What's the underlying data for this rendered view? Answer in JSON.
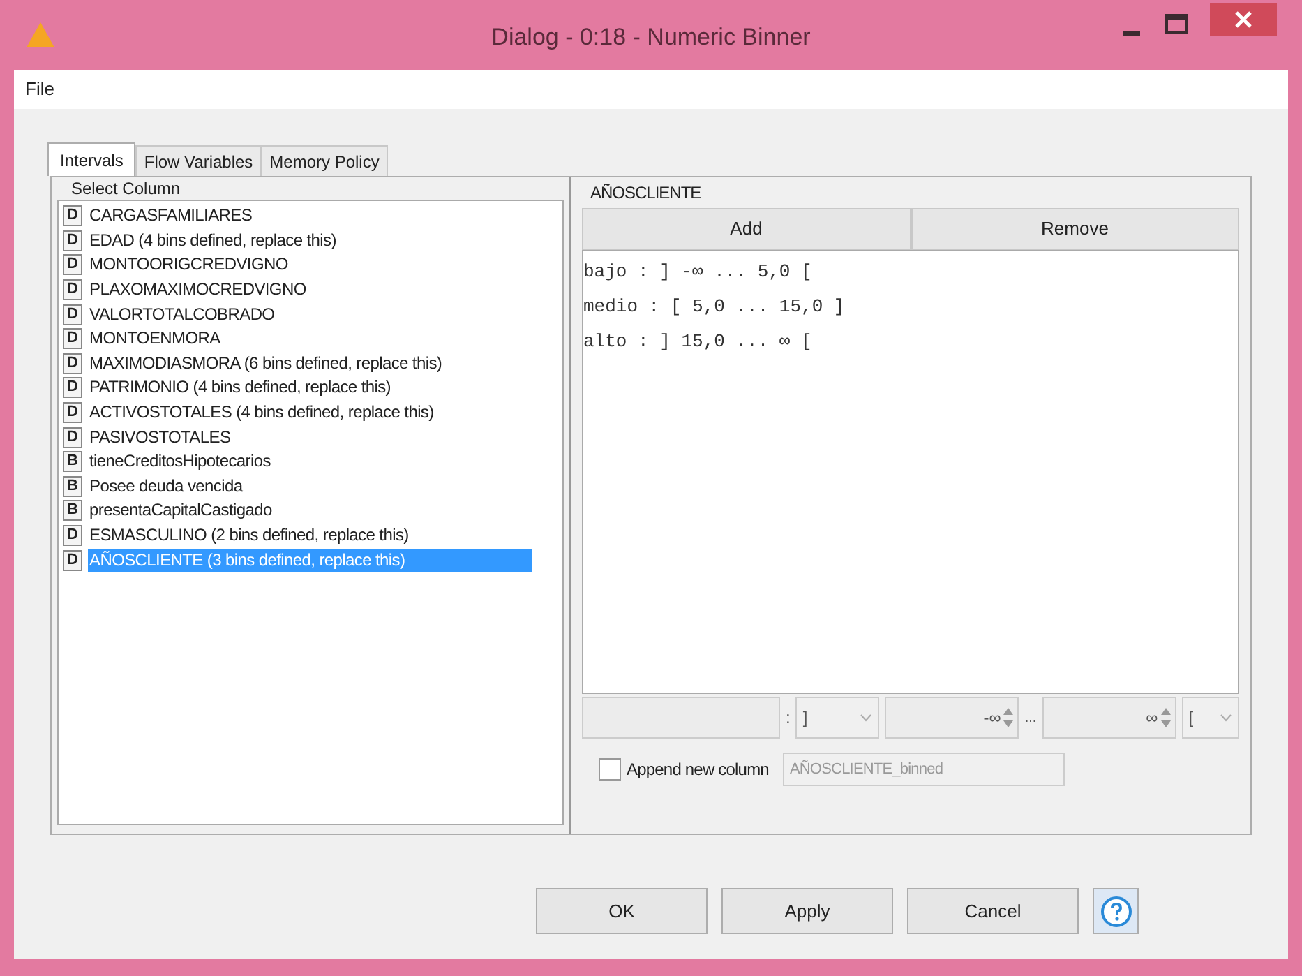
{
  "window": {
    "title": "Dialog - 0:18 - Numeric Binner"
  },
  "menu": [
    "File"
  ],
  "tabs": [
    {
      "label": "Intervals",
      "selected": true
    },
    {
      "label": "Flow Variables",
      "selected": false
    },
    {
      "label": "Memory Policy",
      "selected": false
    }
  ],
  "column_list": {
    "title": "Select Column",
    "items": [
      {
        "type": "D",
        "label": "CARGASFAMILIARES",
        "selected": false
      },
      {
        "type": "D",
        "label": "EDAD (4 bins defined, replace this)",
        "selected": false
      },
      {
        "type": "D",
        "label": "MONTOORIGCREDVIGNO",
        "selected": false
      },
      {
        "type": "D",
        "label": "PLAXOMAXIMOCREDVIGNO",
        "selected": false
      },
      {
        "type": "D",
        "label": "VALORTOTALCOBRADO",
        "selected": false
      },
      {
        "type": "D",
        "label": "MONTOENMORA",
        "selected": false
      },
      {
        "type": "D",
        "label": "MAXIMODIASMORA (6 bins defined, replace this)",
        "selected": false
      },
      {
        "type": "D",
        "label": "PATRIMONIO (4 bins defined, replace this)",
        "selected": false
      },
      {
        "type": "D",
        "label": "ACTIVOSTOTALES (4 bins defined, replace this)",
        "selected": false
      },
      {
        "type": "D",
        "label": "PASIVOSTOTALES",
        "selected": false
      },
      {
        "type": "B",
        "label": "tieneCreditosHipotecarios",
        "selected": false
      },
      {
        "type": "B",
        "label": "Posee deuda vencida",
        "selected": false
      },
      {
        "type": "B",
        "label": "presentaCapitalCastigado",
        "selected": false
      },
      {
        "type": "D",
        "label": "ESMASCULINO (2 bins defined, replace this)",
        "selected": false
      },
      {
        "type": "D",
        "label": "AÑOSCLIENTE (3 bins defined, replace this)",
        "selected": true
      }
    ]
  },
  "bins": {
    "title": "AÑOSCLIENTE",
    "buttons": [
      "Add",
      "Remove"
    ],
    "intervals": [
      "bajo : ] -∞ ... 5,0 [",
      "medio : [ 5,0 ... 15,0 ]",
      "alto : ] 15,0 ... ∞ ["
    ],
    "editor": {
      "colon": ":",
      "left_bracket": "]",
      "left_value": "-∞",
      "separator": "...",
      "right_value": "∞",
      "right_bracket": "["
    },
    "append": {
      "label": "Append new column",
      "checked": false,
      "value": "AÑOSCLIENTE_binned"
    }
  },
  "buttons": [
    "OK",
    "Apply",
    "Cancel"
  ]
}
